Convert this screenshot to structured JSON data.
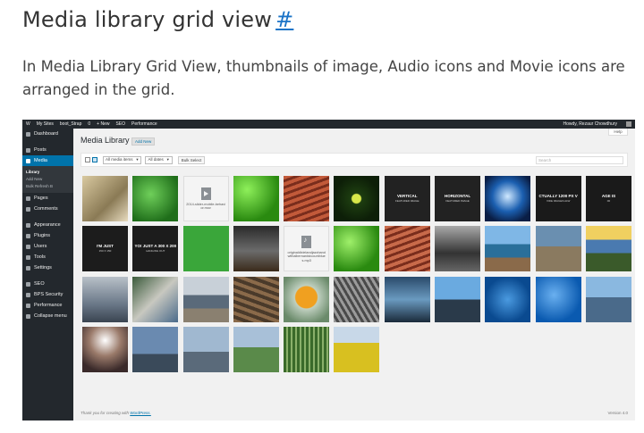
{
  "doc": {
    "title": "Media library grid view",
    "anchor": "#",
    "paragraph": "In Media Library Grid View, thumbnails of image, Audio icons and Movie icons are arranged in the grid."
  },
  "adminbar": {
    "items": [
      "W",
      "My Sites",
      "boot_Strap",
      "0",
      "+ New",
      "SEO",
      "Performance"
    ],
    "howdy": "Howdy, Rezaur Chowdhury"
  },
  "sidebar": {
    "items": [
      {
        "label": "Dashboard",
        "icon": "dashboard-icon"
      },
      {
        "label": "Posts",
        "icon": "pin-icon"
      },
      {
        "label": "Media",
        "icon": "media-icon",
        "active": true
      },
      {
        "label": "Pages",
        "icon": "page-icon"
      },
      {
        "label": "Comments",
        "icon": "comment-icon"
      },
      {
        "label": "Appearance",
        "icon": "brush-icon"
      },
      {
        "label": "Plugins",
        "icon": "plugin-icon"
      },
      {
        "label": "Users",
        "icon": "users-icon"
      },
      {
        "label": "Tools",
        "icon": "wrench-icon"
      },
      {
        "label": "Settings",
        "icon": "settings-icon"
      },
      {
        "label": "SEO",
        "icon": "seo-icon"
      },
      {
        "label": "BPS Security",
        "icon": "shield-icon"
      },
      {
        "label": "Performance",
        "icon": "performance-icon"
      },
      {
        "label": "Collapse menu",
        "icon": "collapse-icon"
      }
    ],
    "submenu": [
      "Library",
      "Add New",
      "Bulk Refresh B"
    ]
  },
  "main": {
    "help": "Help",
    "title": "Media Library",
    "add_new": "Add New",
    "filter_type": "All media items",
    "filter_date": "All dates",
    "bulk_select": "Bulk Select",
    "search_placeholder": "Search",
    "footer_left": "Thank you for creating with",
    "footer_link": "WordPress.",
    "footer_right": "Version 4.0"
  },
  "tiles": [
    {
      "kind": "img",
      "bg": "linear-gradient(135deg,#d9c9a0,#8a7a55 60%,#e8dcc0)"
    },
    {
      "kind": "img",
      "bg": "radial-gradient(circle at 40% 40%,#6fcf5a,#1f6e1a 75%)"
    },
    {
      "kind": "file",
      "icon": "movie",
      "label": "2014-slider-mobile-behavior.mov"
    },
    {
      "kind": "img",
      "bg": "radial-gradient(circle at 30% 30%,#8ef05a,#2a8a10 70%)"
    },
    {
      "kind": "img",
      "bg": "repeating-linear-gradient(160deg,#c25a3a 0 4px,#7a2d1c 4px 7px)"
    },
    {
      "kind": "img",
      "bg": "radial-gradient(circle at 50% 50%,#d8e84a 0 5px,#1d3d10 6px,#0d1f08 70%)"
    },
    {
      "kind": "text",
      "bg": "#222",
      "text": "VERTICAL",
      "sub": "FEATURED IMAGE"
    },
    {
      "kind": "text",
      "bg": "#222",
      "text": "HORIZONTAL",
      "sub": "FEATURED IMAGE"
    },
    {
      "kind": "img",
      "bg": "radial-gradient(circle at 50% 45%,#cfe8ff,#1b5fb0 45%,#0a1e45 80%)"
    },
    {
      "kind": "text",
      "bg": "#1a1a1a",
      "text": "CTUALLY 1200 PX V",
      "sub": "VIDE IMAGES ALW"
    },
    {
      "kind": "text",
      "bg": "#1a1a1a",
      "text": "AGE IS",
      "sub": "00"
    },
    {
      "kind": "text",
      "bg": "#1c1c1c",
      "text": "I'M JUST",
      "sub": "150 X 150"
    },
    {
      "kind": "text",
      "bg": "#1c1c1c",
      "text": "YO! JUST A 300 X 200",
      "sub": "HANGING OUT"
    },
    {
      "kind": "img",
      "bg": "#3aa63a"
    },
    {
      "kind": "img",
      "bg": "linear-gradient(180deg,#2a2a2a,#6b6b6b 55%,#3a2a1a)"
    },
    {
      "kind": "file",
      "icon": "audio",
      "label": "originaldixielandjazzbandwithalbernardstcountblues.mp3"
    },
    {
      "kind": "img",
      "bg": "radial-gradient(circle at 35% 35%,#9ff06a,#2a8a10 70%)"
    },
    {
      "kind": "img",
      "bg": "repeating-linear-gradient(160deg,#c86a4a 0 4px,#7a2d1c 4px 7px)"
    },
    {
      "kind": "img",
      "bg": "linear-gradient(180deg,#aaa,#333 60%,#666)"
    },
    {
      "kind": "img",
      "bg": "linear-gradient(180deg,#7fb7e6 0 40%,#2a6f9a 40% 70%,#8a6a4a 70%)"
    },
    {
      "kind": "img",
      "bg": "linear-gradient(180deg,#6a8fb0 0 45%,#8a7a60 45%)"
    },
    {
      "kind": "img",
      "bg": "linear-gradient(180deg,#f0d060 0 30%,#4a7ab0 30% 60%,#3a5a2a 60%)"
    },
    {
      "kind": "img",
      "bg": "linear-gradient(180deg,#b8c0c8,#6a7888 60%,#3a4450)"
    },
    {
      "kind": "img",
      "bg": "linear-gradient(135deg,#3a5a3a,#c8c8c0 50%,#4a6a8a)"
    },
    {
      "kind": "img",
      "bg": "linear-gradient(180deg,#c8d0d8 0 40%,#5a6a7a 40% 70%,#8a8070 70%)"
    },
    {
      "kind": "img",
      "bg": "repeating-linear-gradient(20deg,#8a6a4a 0 4px,#4a3a2a 4px 8px)"
    },
    {
      "kind": "img",
      "bg": "radial-gradient(circle at 50% 45%,#f0a020 0 12px,#c0d0c0 13px,#6a8a6a 80%)"
    },
    {
      "kind": "img",
      "bg": "repeating-linear-gradient(60deg,#9a9a9a 0 3px,#4a4a4a 3px 6px)"
    },
    {
      "kind": "img",
      "bg": "linear-gradient(180deg,#2a4a6a,#6a9ac0 50%,#1a2a3a)"
    },
    {
      "kind": "img",
      "bg": "linear-gradient(180deg,#6aaae0 0 50%,#2a3a4a 50%)"
    },
    {
      "kind": "img",
      "bg": "radial-gradient(circle at 50% 50%,#4a9ae0,#0a4a90 70%)"
    },
    {
      "kind": "img",
      "bg": "radial-gradient(circle at 40% 40%,#6ab0f0,#0a5ab0 70%)"
    },
    {
      "kind": "img",
      "bg": "linear-gradient(180deg,#8ab8e0 0 45%,#4a6a8a 45%)"
    },
    {
      "kind": "img",
      "bg": "radial-gradient(circle at 50% 30%,#fff,#9a7a6a 40%,#3a2a2a 80%)"
    },
    {
      "kind": "img",
      "bg": "linear-gradient(180deg,#6a8ab0 0 60%,#3a4a5a 60%)"
    },
    {
      "kind": "img",
      "bg": "linear-gradient(180deg,#a0b8d0 0 55%,#5a6a7a 55%)"
    },
    {
      "kind": "img",
      "bg": "linear-gradient(180deg,#a8c0d8 0 45%,#5a8a4a 45%)"
    },
    {
      "kind": "img",
      "bg": "repeating-linear-gradient(90deg,#3a6a2a 0 3px,#8ab06a 3px 5px)"
    },
    {
      "kind": "img",
      "bg": "linear-gradient(180deg,#c8d8e8 0 35%,#d8c020 35%)"
    }
  ]
}
